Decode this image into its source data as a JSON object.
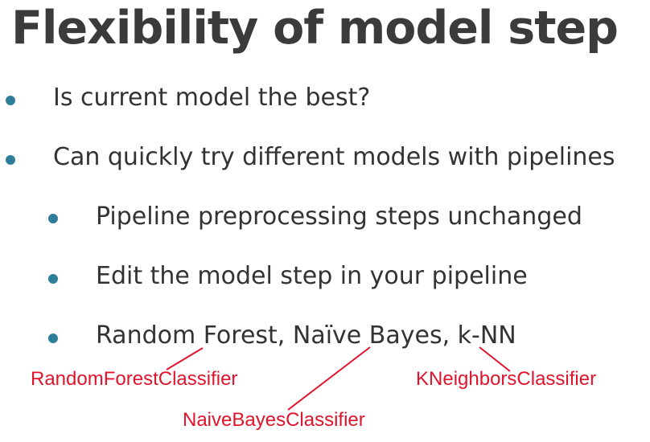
{
  "slide": {
    "title": "Flexibility of model step",
    "bullets": [
      "Is current model the best?",
      "Can quickly try different models with pipelines"
    ],
    "sub_bullets": [
      "Pipeline preprocessing steps unchanged",
      "Edit the model step in your pipeline",
      "Random Forest, Naïve Bayes, k-NN"
    ]
  },
  "annotations": {
    "random_forest": "RandomForestClassifier",
    "naive_bayes": "NaiveBayesClassifier",
    "knn": "KNeighborsClassifier",
    "color": "#e0142c"
  },
  "colors": {
    "bullet": "#2e7e99",
    "title": "#3b3b3b",
    "text": "#333333"
  }
}
